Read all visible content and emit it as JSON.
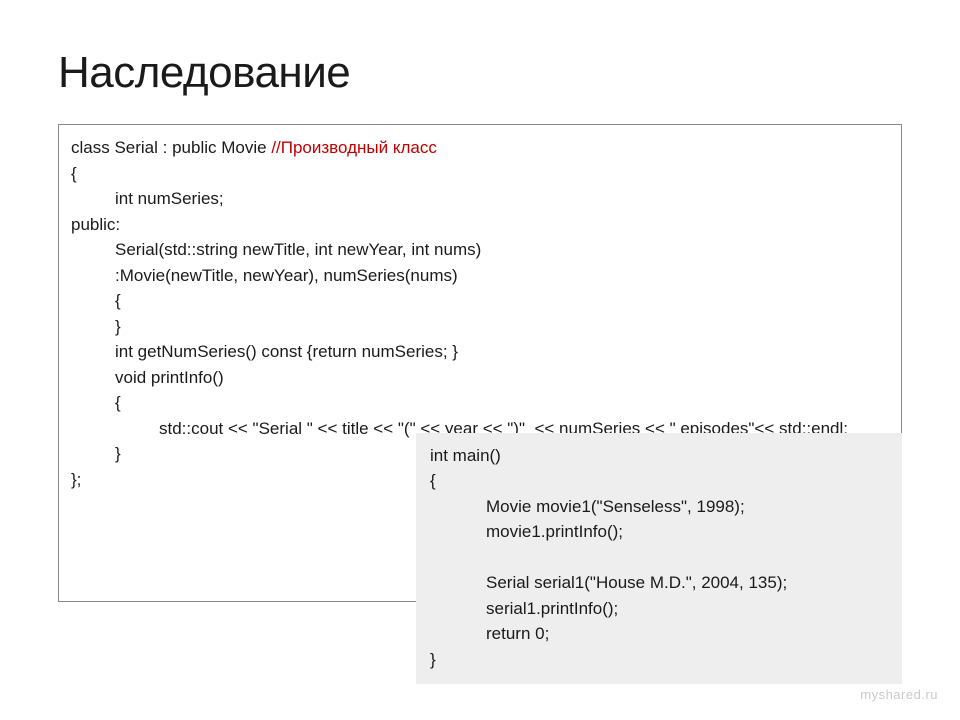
{
  "title": "Наследование",
  "code": {
    "l0a": "class Serial : public Movie ",
    "l0b": "//Производный класс",
    "l1": "{",
    "l2": "int numSeries;",
    "l3": "public:",
    "l4": "Serial(std::string newTitle, int newYear, int nums)",
    "l5": ":Movie(newTitle, newYear), numSeries(nums)",
    "l6": "{",
    "l7": "}",
    "l8": "int getNumSeries() const {return numSeries; }",
    "l9": "void printInfo()",
    "l10": "{",
    "l11": "std::cout << \"Serial \" << title << \"(\" << year << \")\"  << numSeries << \" episodes\"<< std::endl;",
    "l12": "}",
    "l13": "};"
  },
  "inset": {
    "m0": "int main()",
    "m1": "{",
    "m2": "Movie movie1(\"Senseless\", 1998);",
    "m3": "movie1.printInfo();",
    "blank": " ",
    "m4": "Serial serial1(\"House M.D.\", 2004, 135);",
    "m5": "serial1.printInfo();",
    "m6": "return 0;",
    "m7": "}"
  },
  "watermark": "myshared.ru"
}
